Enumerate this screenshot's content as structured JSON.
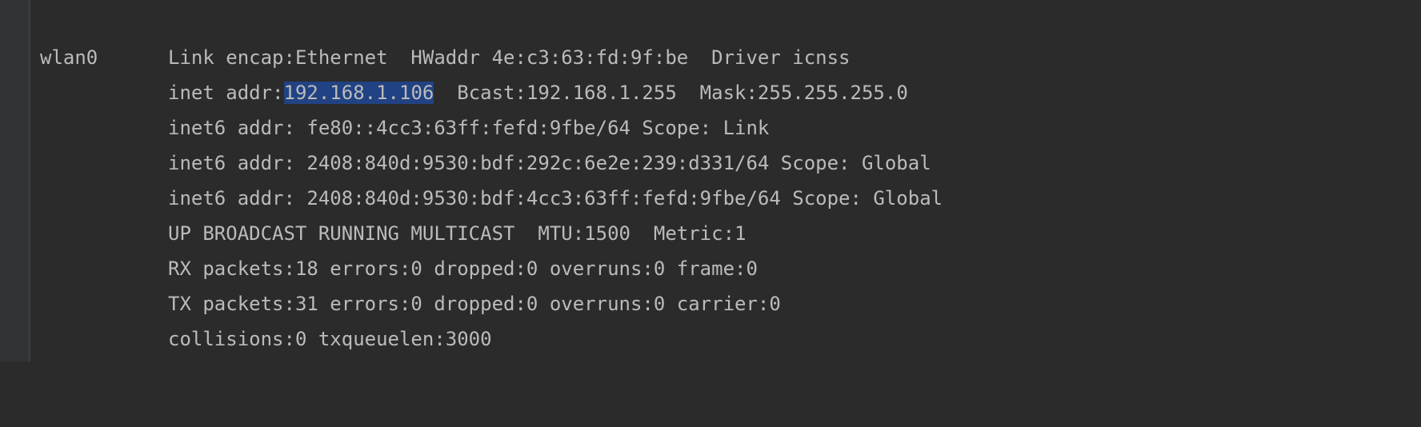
{
  "terminal": {
    "interface": "wlan0",
    "lines": [
      "Link encap:Ethernet  HWaddr 4e:c3:63:fd:9f:be  Driver icnss",
      "inet addr:",
      "inet6 addr: fe80::4cc3:63ff:fefd:9fbe/64 Scope: Link",
      "inet6 addr: 2408:840d:9530:bdf:292c:6e2e:239:d331/64 Scope: Global",
      "inet6 addr: 2408:840d:9530:bdf:4cc3:63ff:fefd:9fbe/64 Scope: Global",
      "UP BROADCAST RUNNING MULTICAST  MTU:1500  Metric:1",
      "RX packets:18 errors:0 dropped:0 overruns:0 frame:0",
      "TX packets:31 errors:0 dropped:0 overruns:0 carrier:0",
      "collisions:0 txqueuelen:3000"
    ],
    "selected_text": "192.168.1.106",
    "after_selection": "  Bcast:192.168.1.255  Mask:255.255.255.0"
  },
  "colors": {
    "background": "#2b2b2b",
    "gutter": "#313335",
    "text": "#bbbbbb",
    "selection": "#214283"
  }
}
